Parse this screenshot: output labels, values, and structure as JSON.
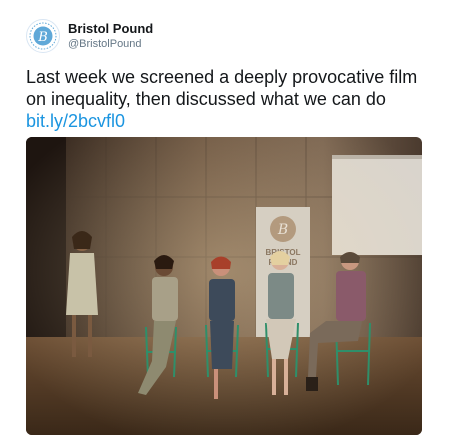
{
  "account": {
    "name": "Bristol Pound",
    "handle": "@BristolPound",
    "avatar_icon": "bristol-pound-logo-icon",
    "brand_color": "#5fa8d8"
  },
  "tweet": {
    "text_line1": "Last week we screened a deeply provocative film",
    "text_line2": "on inequality, then discussed what we can do",
    "link": "bit.ly/2bcvfl0",
    "link_color": "#1b95e0"
  },
  "photo": {
    "banner": {
      "line1": "BRISTOL",
      "line2": "POUND"
    }
  }
}
